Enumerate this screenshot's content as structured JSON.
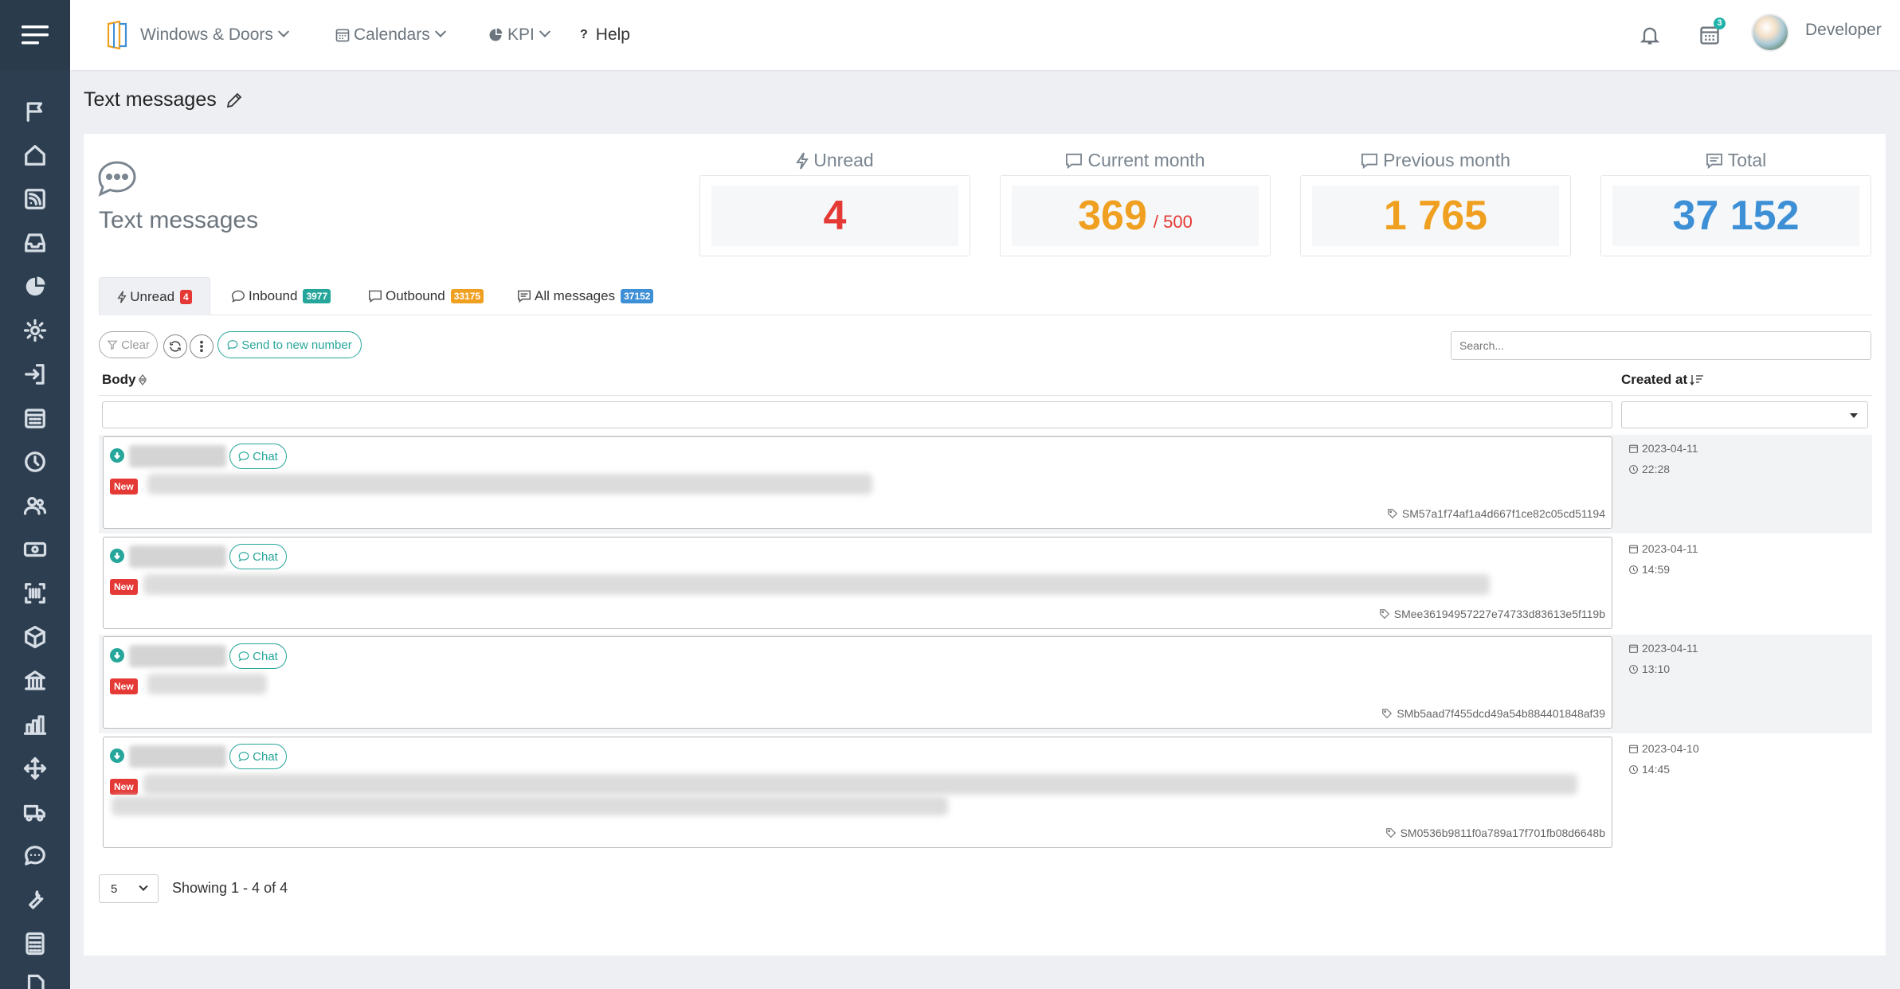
{
  "topnav": {
    "module": "Windows & Doors",
    "calendars": "Calendars",
    "kpi": "KPI",
    "help_mark": "?",
    "help": "Help",
    "calendar_badge": "3",
    "user": "Developer"
  },
  "page": {
    "title": "Text messages"
  },
  "hero": {
    "title": "Text messages"
  },
  "stats": {
    "unread": {
      "label": "Unread",
      "value": "4",
      "color": "#e53935"
    },
    "current": {
      "label": "Current month",
      "value": "369",
      "limit": "/ 500",
      "color": "#f0a020"
    },
    "previous": {
      "label": "Previous month",
      "value": "1 765",
      "color": "#f0a020"
    },
    "total": {
      "label": "Total",
      "value": "37 152",
      "color": "#3d8fd6"
    }
  },
  "tabs": [
    {
      "label": "Unread",
      "badge": "4",
      "badge_color": "#e53935"
    },
    {
      "label": "Inbound",
      "badge": "3977",
      "badge_color": "#26a69a"
    },
    {
      "label": "Outbound",
      "badge": "33175",
      "badge_color": "#f0a020"
    },
    {
      "label": "All messages",
      "badge": "37152",
      "badge_color": "#3d8fd6"
    }
  ],
  "toolbar": {
    "clear": "Clear",
    "send_new": "Send to new number",
    "search_placeholder": "Search..."
  },
  "table": {
    "col_body": "Body",
    "col_created": "Created at",
    "chat_label": "Chat",
    "new_label": "New",
    "rows": [
      {
        "sid": "SM57a1f74af1a4d667f1ce82c05cd51194",
        "date": "2023-04-11",
        "time": "22:28"
      },
      {
        "sid": "SMee36194957227e74733d83613e5f119b",
        "date": "2023-04-11",
        "time": "14:59"
      },
      {
        "sid": "SMb5aad7f455dcd49a54b884401848af39",
        "date": "2023-04-11",
        "time": "13:10"
      },
      {
        "sid": "SM0536b9811f0a789a17f701fb08d6648b",
        "date": "2023-04-10",
        "time": "14:45"
      }
    ]
  },
  "footer": {
    "page_size": "5",
    "showing": "Showing 1 - 4 of 4"
  }
}
